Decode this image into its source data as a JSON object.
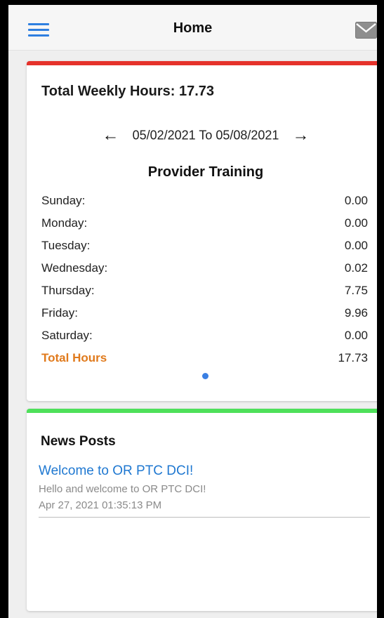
{
  "header": {
    "title": "Home",
    "menu_icon": "hamburger-menu-icon",
    "mail_icon": "envelope-icon"
  },
  "weekly": {
    "title": "Total Weekly Hours: 17.73",
    "accent_color": "#e5322b",
    "date_range": "05/02/2021 To 05/08/2021",
    "prev_icon": "left-arrow-icon",
    "next_icon": "right-arrow-icon",
    "program": "Provider Training",
    "rows": [
      {
        "day": "Sunday:",
        "hours": "0.00"
      },
      {
        "day": "Monday:",
        "hours": "0.00"
      },
      {
        "day": "Tuesday:",
        "hours": "0.00"
      },
      {
        "day": "Wednesday:",
        "hours": "0.02"
      },
      {
        "day": "Thursday:",
        "hours": "7.75"
      },
      {
        "day": "Friday:",
        "hours": "9.96"
      },
      {
        "day": "Saturday:",
        "hours": "0.00"
      }
    ],
    "total_label": "Total Hours",
    "total_value": "17.73",
    "total_color": "#e07a1c"
  },
  "news": {
    "title": "News Posts",
    "accent_color": "#4ee05a",
    "posts": [
      {
        "title": "Welcome to OR PTC DCI!",
        "body": "Hello and welcome to OR PTC DCI!",
        "date": "Apr 27, 2021 01:35:13 PM"
      }
    ]
  }
}
